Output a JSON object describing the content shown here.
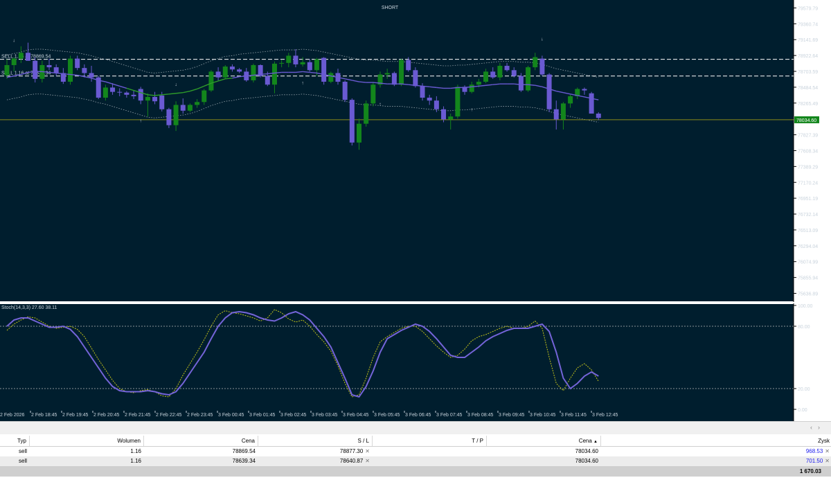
{
  "chart": {
    "signal_label": "SHORT",
    "current_price_label": "78034.60",
    "stoch_label": "Stoch(14,3,3) 27.60 38.11",
    "order_lines": [
      {
        "label": "SELL 1.16 at 78869.54",
        "price": 78869.54
      },
      {
        "label": "SELL 1.16 at 78639.34",
        "price": 78639.34
      }
    ],
    "current_price": 78034.6,
    "price_axis_labels": [
      "79579.79",
      "79360.74",
      "79141.69",
      "78922.64",
      "78703.59",
      "78484.54",
      "78265.49",
      "78034.60",
      "77827.39",
      "77608.34",
      "77389.29",
      "77170.24",
      "76951.19",
      "76732.14",
      "76513.09",
      "76294.04",
      "76074.99",
      "75855.94",
      "75636.89"
    ],
    "stoch_axis_labels": [
      "100.00",
      "80.00",
      "20.00",
      "0.00"
    ],
    "time_axis_labels": [
      "2 Feb 2026",
      "2 Feb 18:45",
      "2 Feb 19:45",
      "2 Feb 20:45",
      "2 Feb 21:45",
      "2 Feb 22:45",
      "2 Feb 23:45",
      "3 Feb 00:45",
      "3 Feb 01:45",
      "3 Feb 02:45",
      "3 Feb 03:45",
      "3 Feb 04:45",
      "3 Feb 05:45",
      "3 Feb 06:45",
      "3 Feb 07:45",
      "3 Feb 08:45",
      "3 Feb 09:45",
      "3 Feb 10:45",
      "3 Feb 11:45",
      "3 Feb 12:45"
    ],
    "colors": {
      "background": "#001e2e",
      "bull": "#13861c",
      "bear": "#6a5ad2",
      "ma": "#6a5ad2",
      "ma_green": "#2e9b2a",
      "band": "#9aa6ad",
      "price_line": "#8c8a1a",
      "signal": "#e0244a",
      "arrow": "#e3a21a",
      "stoch_k": "#7464d8",
      "stoch_d": "#c4c418",
      "level": "#b8b8b8"
    }
  },
  "chart_data": {
    "type": "candlestick",
    "price_ylim": [
      75526.87,
      79689.32
    ],
    "candles": [
      {
        "o": 78650,
        "h": 78870,
        "l": 78600,
        "c": 78790
      },
      {
        "o": 78790,
        "h": 78900,
        "l": 78700,
        "c": 78880
      },
      {
        "o": 78880,
        "h": 79050,
        "l": 78820,
        "c": 78960
      },
      {
        "o": 78960,
        "h": 79100,
        "l": 78850,
        "c": 78850
      },
      {
        "o": 78850,
        "h": 78900,
        "l": 78550,
        "c": 78600
      },
      {
        "o": 78600,
        "h": 78850,
        "l": 78550,
        "c": 78790
      },
      {
        "o": 78790,
        "h": 78880,
        "l": 78720,
        "c": 78760
      },
      {
        "o": 78760,
        "h": 78800,
        "l": 78640,
        "c": 78680
      },
      {
        "o": 78680,
        "h": 78750,
        "l": 78530,
        "c": 78560
      },
      {
        "o": 78560,
        "h": 78920,
        "l": 78520,
        "c": 78880
      },
      {
        "o": 78880,
        "h": 78920,
        "l": 78720,
        "c": 78750
      },
      {
        "o": 78750,
        "h": 78800,
        "l": 78620,
        "c": 78680
      },
      {
        "o": 78680,
        "h": 78780,
        "l": 78560,
        "c": 78620
      },
      {
        "o": 78620,
        "h": 78640,
        "l": 78320,
        "c": 78340
      },
      {
        "o": 78340,
        "h": 78520,
        "l": 78300,
        "c": 78480
      },
      {
        "o": 78480,
        "h": 78540,
        "l": 78380,
        "c": 78420
      },
      {
        "o": 78420,
        "h": 78470,
        "l": 78360,
        "c": 78410
      },
      {
        "o": 78410,
        "h": 78430,
        "l": 78340,
        "c": 78380
      },
      {
        "o": 78380,
        "h": 78440,
        "l": 78320,
        "c": 78360
      },
      {
        "o": 78460,
        "h": 78490,
        "l": 78250,
        "c": 78300
      },
      {
        "o": 78300,
        "h": 78400,
        "l": 78080,
        "c": 78350
      },
      {
        "o": 78350,
        "h": 78420,
        "l": 78250,
        "c": 78290
      },
      {
        "o": 78370,
        "h": 78420,
        "l": 78150,
        "c": 78180
      },
      {
        "o": 78180,
        "h": 78200,
        "l": 77920,
        "c": 77960
      },
      {
        "o": 77960,
        "h": 78290,
        "l": 77880,
        "c": 78240
      },
      {
        "o": 78240,
        "h": 78330,
        "l": 78120,
        "c": 78160
      },
      {
        "o": 78160,
        "h": 78260,
        "l": 78140,
        "c": 78240
      },
      {
        "o": 78240,
        "h": 78320,
        "l": 78200,
        "c": 78280
      },
      {
        "o": 78280,
        "h": 78460,
        "l": 78240,
        "c": 78440
      },
      {
        "o": 78440,
        "h": 78720,
        "l": 78420,
        "c": 78700
      },
      {
        "o": 78700,
        "h": 78760,
        "l": 78580,
        "c": 78620
      },
      {
        "o": 78620,
        "h": 78790,
        "l": 78600,
        "c": 78770
      },
      {
        "o": 78770,
        "h": 78800,
        "l": 78700,
        "c": 78730
      },
      {
        "o": 78730,
        "h": 78750,
        "l": 78680,
        "c": 78700
      },
      {
        "o": 78700,
        "h": 78750,
        "l": 78560,
        "c": 78580
      },
      {
        "o": 78580,
        "h": 78810,
        "l": 78550,
        "c": 78790
      },
      {
        "o": 78790,
        "h": 78800,
        "l": 78620,
        "c": 78640
      },
      {
        "o": 78640,
        "h": 78700,
        "l": 78500,
        "c": 78520
      },
      {
        "o": 78520,
        "h": 78840,
        "l": 78400,
        "c": 78810
      },
      {
        "o": 78810,
        "h": 78860,
        "l": 78760,
        "c": 78820
      },
      {
        "o": 78820,
        "h": 78960,
        "l": 78760,
        "c": 78920
      },
      {
        "o": 78920,
        "h": 79010,
        "l": 78760,
        "c": 78800
      },
      {
        "o": 78800,
        "h": 78900,
        "l": 78770,
        "c": 78830
      },
      {
        "o": 78830,
        "h": 78870,
        "l": 78700,
        "c": 78720
      },
      {
        "o": 78720,
        "h": 78890,
        "l": 78640,
        "c": 78870
      },
      {
        "o": 78890,
        "h": 78900,
        "l": 78520,
        "c": 78560
      },
      {
        "o": 78560,
        "h": 78700,
        "l": 78540,
        "c": 78680
      },
      {
        "o": 78680,
        "h": 78740,
        "l": 78520,
        "c": 78560
      },
      {
        "o": 78560,
        "h": 78580,
        "l": 78280,
        "c": 78310
      },
      {
        "o": 78310,
        "h": 78330,
        "l": 77680,
        "c": 77720
      },
      {
        "o": 77720,
        "h": 78050,
        "l": 77620,
        "c": 77980
      },
      {
        "o": 77980,
        "h": 78300,
        "l": 77940,
        "c": 78260
      },
      {
        "o": 78260,
        "h": 78560,
        "l": 78220,
        "c": 78520
      },
      {
        "o": 78520,
        "h": 78700,
        "l": 78480,
        "c": 78660
      },
      {
        "o": 78660,
        "h": 78740,
        "l": 78600,
        "c": 78680
      },
      {
        "o": 78680,
        "h": 78700,
        "l": 78500,
        "c": 78520
      },
      {
        "o": 78520,
        "h": 78880,
        "l": 78500,
        "c": 78860
      },
      {
        "o": 78860,
        "h": 78900,
        "l": 78700,
        "c": 78720
      },
      {
        "o": 78720,
        "h": 78760,
        "l": 78480,
        "c": 78500
      },
      {
        "o": 78500,
        "h": 78540,
        "l": 78300,
        "c": 78340
      },
      {
        "o": 78340,
        "h": 78380,
        "l": 78240,
        "c": 78300
      },
      {
        "o": 78300,
        "h": 78360,
        "l": 78140,
        "c": 78180
      },
      {
        "o": 78180,
        "h": 78220,
        "l": 78000,
        "c": 78040
      },
      {
        "o": 78040,
        "h": 78120,
        "l": 77900,
        "c": 78080
      },
      {
        "o": 78080,
        "h": 78520,
        "l": 78050,
        "c": 78490
      },
      {
        "o": 78490,
        "h": 78510,
        "l": 78380,
        "c": 78420
      },
      {
        "o": 78420,
        "h": 78560,
        "l": 78400,
        "c": 78520
      },
      {
        "o": 78520,
        "h": 78600,
        "l": 78480,
        "c": 78560
      },
      {
        "o": 78560,
        "h": 78740,
        "l": 78540,
        "c": 78700
      },
      {
        "o": 78700,
        "h": 78760,
        "l": 78600,
        "c": 78620
      },
      {
        "o": 78620,
        "h": 78820,
        "l": 78580,
        "c": 78780
      },
      {
        "o": 78780,
        "h": 78820,
        "l": 78700,
        "c": 78720
      },
      {
        "o": 78720,
        "h": 78760,
        "l": 78620,
        "c": 78640
      },
      {
        "o": 78640,
        "h": 78680,
        "l": 78420,
        "c": 78440
      },
      {
        "o": 78440,
        "h": 78780,
        "l": 78420,
        "c": 78760
      },
      {
        "o": 78760,
        "h": 78960,
        "l": 78720,
        "c": 78900
      },
      {
        "o": 78880,
        "h": 78920,
        "l": 78640,
        "c": 78660
      },
      {
        "o": 78660,
        "h": 78680,
        "l": 78140,
        "c": 78180
      },
      {
        "o": 78180,
        "h": 78300,
        "l": 77900,
        "c": 78040
      },
      {
        "o": 78040,
        "h": 78280,
        "l": 77900,
        "c": 78260
      },
      {
        "o": 78260,
        "h": 78380,
        "l": 78200,
        "c": 78360
      },
      {
        "o": 78360,
        "h": 78480,
        "l": 78320,
        "c": 78460
      },
      {
        "o": 78460,
        "h": 78480,
        "l": 78380,
        "c": 78440
      },
      {
        "o": 78400,
        "h": 78420,
        "l": 78120,
        "c": 78120
      },
      {
        "o": 78120,
        "h": 78140,
        "l": 78030,
        "c": 78060
      }
    ],
    "ma_values": [
      78620,
      78640,
      78660,
      78690,
      78700,
      78700,
      78690,
      78680,
      78670,
      78660,
      78650,
      78630,
      78610,
      78580,
      78560,
      78530,
      78500,
      78470,
      78440,
      78410,
      78380,
      78370,
      78380,
      78390,
      78400,
      78410,
      78430,
      78460,
      78500,
      78540,
      78570,
      78600,
      78610,
      78630,
      78640,
      78650,
      78660,
      78670,
      78680,
      78690,
      78690,
      78690,
      78700,
      78690,
      78680,
      78660,
      78640,
      78620,
      78600,
      78580,
      78560,
      78550,
      78550,
      78540,
      78530,
      78530,
      78530,
      78520,
      78510,
      78500,
      78490,
      78480,
      78470,
      78470,
      78480,
      78480,
      78490,
      78500,
      78510,
      78520,
      78530,
      78530,
      78530,
      78520,
      78520,
      78510,
      78490,
      78460,
      78430,
      78410,
      78390,
      78370,
      78350,
      78330,
      78310
    ],
    "band_gap": 310,
    "arrows_down": [
      1,
      24,
      76
    ],
    "arrows_up": [
      19,
      42,
      53,
      66
    ],
    "stoch_ylim": [
      0,
      100
    ],
    "stoch_levels": [
      80,
      20
    ],
    "stoch_k": [
      80,
      86,
      88,
      88,
      85,
      82,
      79,
      79,
      80,
      77,
      70,
      60,
      50,
      40,
      30,
      22,
      18,
      17,
      17,
      17,
      18,
      17,
      15,
      14,
      17,
      25,
      35,
      45,
      55,
      68,
      80,
      88,
      93,
      94,
      93,
      91,
      88,
      86,
      85,
      88,
      92,
      94,
      91,
      86,
      78,
      70,
      60,
      45,
      30,
      14,
      12,
      22,
      37,
      55,
      68,
      72,
      76,
      79,
      82,
      80,
      75,
      68,
      60,
      52,
      50,
      50,
      55,
      60,
      66,
      70,
      73,
      76,
      78,
      78,
      78,
      80,
      82,
      75,
      55,
      30,
      20,
      25,
      32,
      36,
      32
    ],
    "stoch_d": [
      76,
      82,
      86,
      89,
      88,
      84,
      80,
      78,
      79,
      80,
      77,
      70,
      59,
      48,
      38,
      28,
      20,
      17,
      16,
      18,
      19,
      17,
      13,
      12,
      20,
      33,
      44,
      55,
      67,
      80,
      91,
      95,
      93,
      92,
      90,
      88,
      85,
      88,
      96,
      93,
      87,
      84,
      86,
      80,
      72,
      65,
      56,
      42,
      25,
      12,
      14,
      30,
      50,
      65,
      70,
      74,
      78,
      80,
      80,
      75,
      68,
      61,
      55,
      50,
      52,
      58,
      66,
      70,
      72,
      75,
      78,
      80,
      78,
      78,
      80,
      85,
      78,
      50,
      25,
      18,
      30,
      40,
      44,
      38,
      27
    ]
  },
  "trades": {
    "headers": {
      "type": "Typ",
      "volume": "Wolumen",
      "price": "Cena",
      "sl": "S / L",
      "tp": "T / P",
      "current": "Cena",
      "profit": "Zysk"
    },
    "sort_icon": "▲",
    "rows": [
      {
        "type": "sell",
        "volume": "1.16",
        "price": "78869.54",
        "sl": "78877.30",
        "tp": "",
        "current": "78034.60",
        "profit": "968.53"
      },
      {
        "type": "sell",
        "volume": "1.16",
        "price": "78639.34",
        "sl": "78640.87",
        "tp": "",
        "current": "78034.60",
        "profit": "701.50"
      }
    ],
    "total_profit": "1 670.03"
  },
  "toolbar": {
    "scroll_left": "‹",
    "scroll_right": "›"
  }
}
